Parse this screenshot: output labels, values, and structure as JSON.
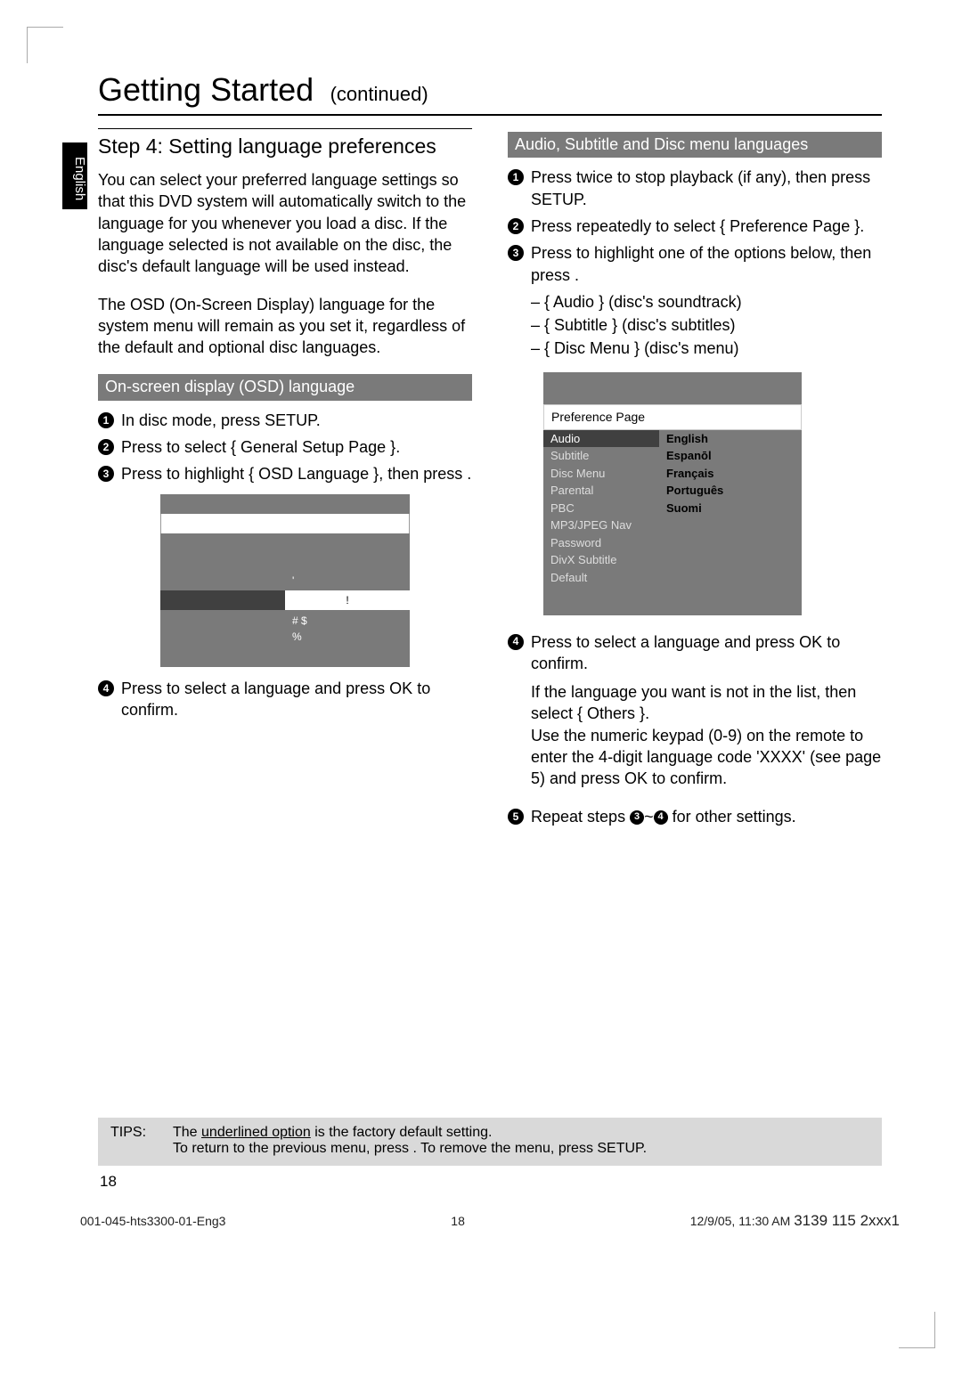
{
  "side_tab": "English",
  "header": {
    "title": "Getting Started",
    "subtitle": "(continued)"
  },
  "left": {
    "subheader": "Step 4: Setting language preferences",
    "p1": "You can select your preferred language settings so that this DVD system will automatically switch to the language for you whenever you load a disc.  If the language selected is not available on the disc, the disc's default language will be used instead.",
    "p2": "The OSD (On-Screen Display) language for the system menu will remain as you set it, regardless of the default and optional disc languages.",
    "bar": "On-screen display (OSD) language",
    "s1": "In disc mode, press SETUP.",
    "s2": "Press     to select { General Setup Page }.",
    "s3a": "Press        to highlight { OSD Language }, then press    .",
    "fig_cell": "!",
    "fig_sym1": "'",
    "fig_sym2": "#    $",
    "fig_sym3": "%",
    "s4": "Press        to select a language and press OK  to confirm."
  },
  "right": {
    "bar": "Audio, Subtitle and Disc menu languages",
    "s1": "Press      twice to stop playback (if any), then press SETUP.",
    "s2": "Press    repeatedly to select { Preference Page }.",
    "s3": "Press        to highlight one of the options below, then press   .",
    "opts": [
      "–  { Audio  } (disc's soundtrack)",
      "–  { Subtitle  } (disc's subtitles)",
      "–  { Disc Menu } (disc's menu)"
    ],
    "fig": {
      "title": "Preference Page",
      "left": [
        "Audio",
        "Subtitle",
        "Disc Menu",
        "Parental",
        "PBC",
        "MP3/JPEG Nav",
        "Password",
        "DivX Subtitle",
        "Default"
      ],
      "right": [
        "English",
        "Espanōl",
        "Français",
        "Português",
        "Suomi"
      ]
    },
    "s4": "Press        to select a language and press OK  to confirm.",
    "p5a": "If the language you want is not in the list, then select   { Others  }.",
    "p5b": "Use the numeric keypad (0-9)   on the remote to enter the 4-digit language code 'XXXX' (see page 5) and press OK  to confirm.",
    "s5a": "Repeat steps ",
    "s5b": "~",
    "s5c": " for other settings."
  },
  "tips": {
    "label": "TIPS:",
    "line1a": "The ",
    "line1u": "underlined option",
    "line1b": " is the factory default setting.",
    "line2": "To return to the previous menu, press   .  To remove the menu, press SETUP."
  },
  "pagenum": "18",
  "footer": {
    "left": "001-045-hts3300-01-Eng3",
    "mid": "18",
    "right_small": "12/9/05, 11:30 AM",
    "right_big": "3139 115 2xxx1"
  }
}
